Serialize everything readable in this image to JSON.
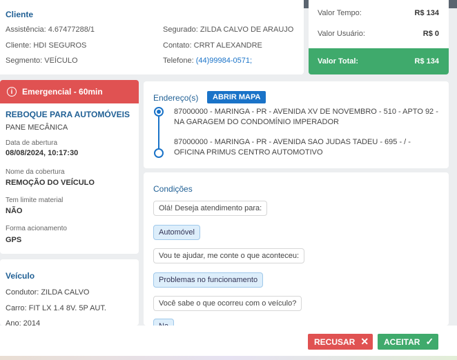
{
  "client": {
    "title": "Cliente",
    "assistencia": "Assistência: 4.67477288/1",
    "cliente": "Cliente: HDI SEGUROS",
    "segmento": "Segmento: VEÍCULO",
    "segurado": "Segurado: ZILDA CALVO DE ARAUJO",
    "contato": "Contato: CRRT ALEXANDRE",
    "telefone_label": "Telefone:",
    "telefone_value": "(44)99984-0571;"
  },
  "values": {
    "tempo_label": "Valor Tempo:",
    "tempo_value": "R$ 134",
    "usuario_label": "Valor Usuário:",
    "usuario_value": "R$ 0",
    "total_label": "Valor Total:",
    "total_value": "R$ 134"
  },
  "emergency": {
    "icon": "info-icon",
    "label": "Emergencial - 60min"
  },
  "service": {
    "title": "REBOQUE PARA AUTOMÓVEIS",
    "subtitle": "PANE MECÂNICA",
    "abertura_label": "Data de abertura",
    "abertura_value": "08/08/2024, 10:17:30",
    "cobertura_label": "Nome da cobertura",
    "cobertura_value": "REMOÇÃO DO VEÍCULO",
    "limite_label": "Tem limite material",
    "limite_value": "NÃO",
    "acionamento_label": "Forma acionamento",
    "acionamento_value": "GPS"
  },
  "vehicle": {
    "title": "Veículo",
    "condutor": "Condutor: ZILDA CALVO",
    "carro": "Carro: FIT LX 1.4 8V. 5P AUT.",
    "ano": "Ano: 2014"
  },
  "address": {
    "title": "Endereço(s)",
    "map_button": "ABRIR MAPA",
    "origin_line1": "87000000 - MARINGA - PR - AVENIDA XV DE NOVEMBRO - 510 - APTO 92 -",
    "origin_line2": "NA GARAGEM DO CONDOMÍNIO IMPERADOR",
    "dest_line1": "87000000 - MARINGA - PR - AVENIDA SAO JUDAS TADEU - 695 - / -",
    "dest_line2": "OFICINA PRIMUS CENTRO AUTOMOTIVO"
  },
  "conditions": {
    "title": "Condições",
    "messages": [
      "Olá! Deseja atendimento para:",
      "Automóvel",
      "Vou te ajudar, me conte o que aconteceu:",
      "Problemas no funcionamento",
      "Você sabe o que ocorreu com o veículo?",
      "Na"
    ]
  },
  "footer": {
    "refuse_label": "RECUSAR",
    "refuse_icon": "close-icon",
    "accept_label": "ACEITAR",
    "accept_icon": "check-icon"
  },
  "colors": {
    "primary": "#1a73c8",
    "danger": "#e05252",
    "success": "#3faa6c",
    "heading": "#1f5f94"
  }
}
